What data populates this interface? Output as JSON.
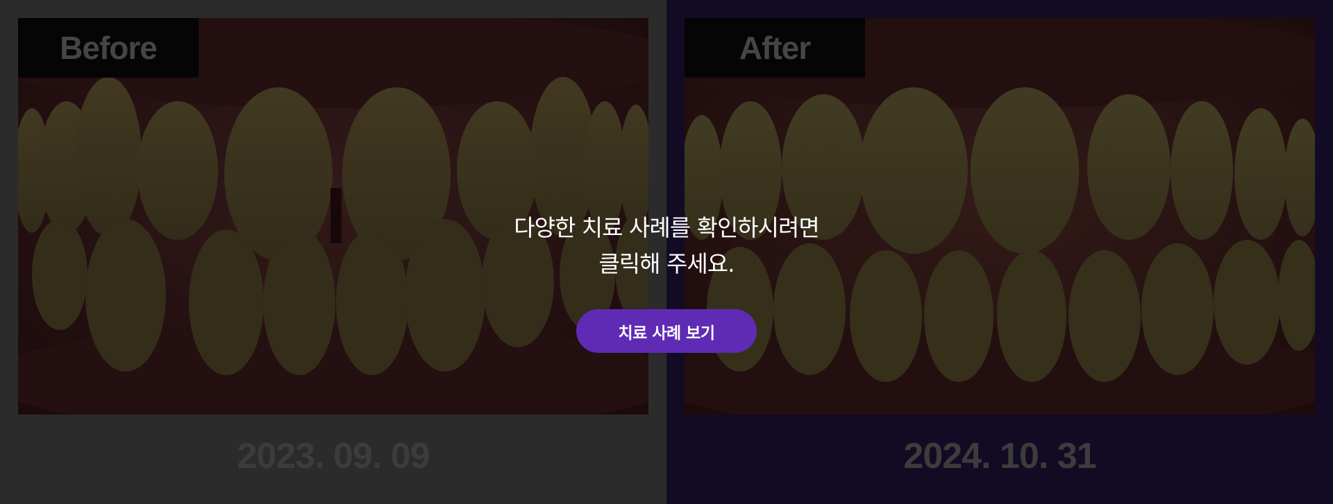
{
  "before": {
    "label": "Before",
    "date": "2023. 09. 09"
  },
  "after": {
    "label": "After",
    "date": "2024. 10. 31"
  },
  "overlay": {
    "message_line1": "다양한 치료 사례를 확인하시려면",
    "message_line2": "클릭해 주세요.",
    "button_label": "치료 사례 보기"
  },
  "colors": {
    "before_bg": "#2b2b2b",
    "after_bg": "#130b24",
    "button_bg": "#5f2bb5",
    "label_bg": "#050505"
  }
}
